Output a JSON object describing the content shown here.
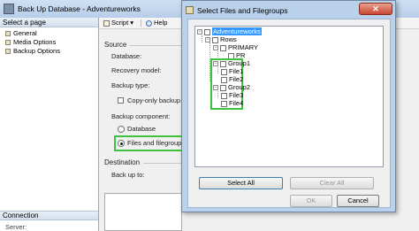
{
  "window": {
    "title": "Back Up Database - Adventureworks"
  },
  "left_panel": {
    "header": "Select a page",
    "items": [
      {
        "label": "General"
      },
      {
        "label": "Media Options"
      },
      {
        "label": "Backup Options"
      }
    ],
    "connection_header": "Connection",
    "server_label": "Server:"
  },
  "toolbar": {
    "script_label": "Script",
    "script_arrow": "▾",
    "help_label": "Help"
  },
  "main": {
    "source_label": "Source",
    "database_label": "Database:",
    "recovery_label": "Recovery model:",
    "backup_type_label": "Backup type:",
    "copy_only_label": "Copy-only backup",
    "component_label": "Backup component:",
    "component_options": [
      {
        "label": "Database",
        "selected": false
      },
      {
        "label": "Files and filegroups:",
        "selected": true
      }
    ],
    "destination_label": "Destination",
    "back_up_to_label": "Back up to:"
  },
  "dialog": {
    "title": "Select Files and Filegroups",
    "close_glyph": "✕",
    "tree": {
      "root": "Adventureworks",
      "rows_label": "Rows",
      "primary_label": "PRIMARY",
      "pr_label": "PR",
      "group1_label": "Group1",
      "file1_label": "File1",
      "file2_label": "File2",
      "group2_label": "Group2",
      "file3_label": "File3",
      "file4_label": "File4",
      "expand_glyph": "−"
    },
    "select_all_label": "Select All",
    "clear_all_label": "Clear All",
    "ok_label": "OK",
    "cancel_label": "Cancel"
  },
  "colors": {
    "highlight_green": "#3fc03f",
    "selection_blue": "#3399ff"
  }
}
